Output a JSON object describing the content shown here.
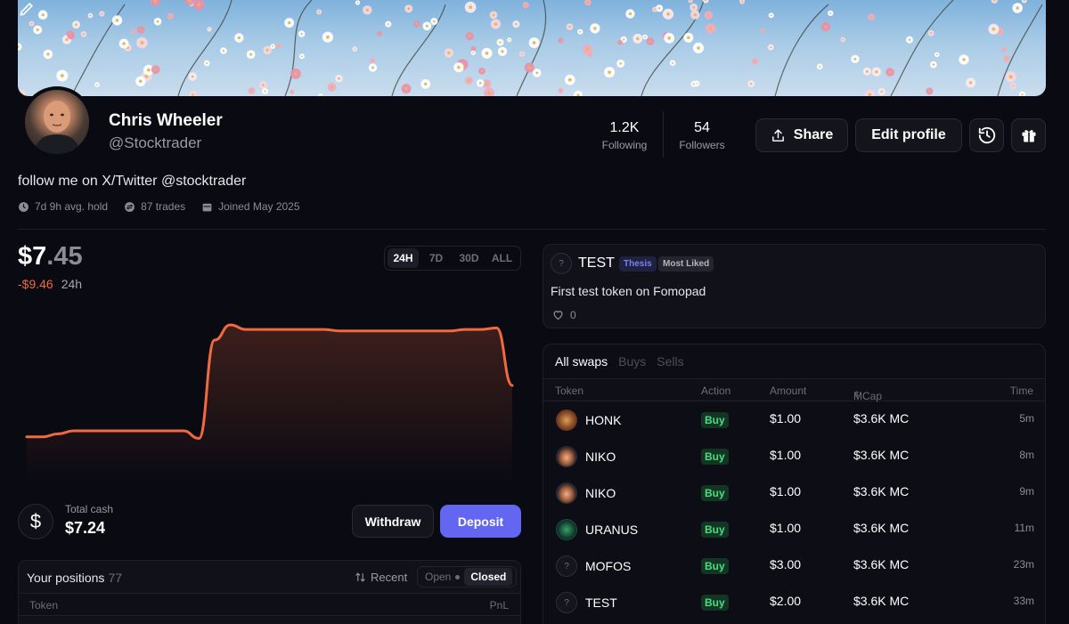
{
  "profile": {
    "display_name": "Chris Wheeler",
    "username": "@Stocktrader",
    "bio": "follow me on X/Twitter @stocktrader",
    "meta": {
      "avg_hold": "7d 9h avg. hold",
      "trades": "87 trades",
      "joined": "Joined May 2025"
    }
  },
  "stats": {
    "following": {
      "value": "1.2K",
      "label": "Following"
    },
    "followers": {
      "value": "54",
      "label": "Followers"
    }
  },
  "actions": {
    "share": "Share",
    "edit_profile": "Edit profile"
  },
  "portfolio": {
    "value_main": "$7",
    "value_frac": ".45",
    "change": "-$9.46",
    "period": "24h",
    "ranges": [
      "24H",
      "7D",
      "30D",
      "ALL"
    ],
    "active_range": "24H",
    "chart_points": [
      0.26,
      0.26,
      0.28,
      0.3,
      0.3,
      0.3,
      0.3,
      0.3,
      0.3,
      0.3,
      0.3,
      0.25,
      0.9,
      1.0,
      0.97,
      0.97,
      0.97,
      0.97,
      0.97,
      0.97,
      0.96,
      0.96,
      0.96,
      0.96,
      0.96,
      0.96,
      0.96,
      0.96,
      0.97,
      0.97,
      0.98,
      0.6
    ],
    "line_color": "#f0693f"
  },
  "cash": {
    "label": "Total cash",
    "value": "$7.24",
    "withdraw": "Withdraw",
    "deposit": "Deposit"
  },
  "positions": {
    "title": "Your positions",
    "count": "77",
    "sort": "Recent",
    "open": "Open",
    "closed": "Closed",
    "col_token": "Token",
    "col_pnl": "PnL"
  },
  "thesis": {
    "token": "TEST",
    "badge_thesis": "Thesis",
    "badge_liked": "Most Liked",
    "description": "First test token on Fomopad",
    "likes": "0"
  },
  "swaps": {
    "tabs": [
      "All swaps",
      "Buys",
      "Sells"
    ],
    "columns": {
      "token": "Token",
      "action": "Action",
      "amount": "Amount",
      "mcap": "MCap",
      "time": "Time"
    },
    "rows": [
      {
        "token": "HONK",
        "icon": "honk",
        "action": "Buy",
        "amount": "$1.00",
        "mcap": "$3.6K MC",
        "time": "5m"
      },
      {
        "token": "NIKO",
        "icon": "niko",
        "action": "Buy",
        "amount": "$1.00",
        "mcap": "$3.6K MC",
        "time": "8m"
      },
      {
        "token": "NIKO",
        "icon": "niko",
        "action": "Buy",
        "amount": "$1.00",
        "mcap": "$3.6K MC",
        "time": "9m"
      },
      {
        "token": "URANUS",
        "icon": "uranus",
        "action": "Buy",
        "amount": "$1.00",
        "mcap": "$3.6K MC",
        "time": "11m"
      },
      {
        "token": "MOFOS",
        "icon": "unk",
        "action": "Buy",
        "amount": "$3.00",
        "mcap": "$3.6K MC",
        "time": "23m"
      },
      {
        "token": "TEST",
        "icon": "unk",
        "action": "Buy",
        "amount": "$2.00",
        "mcap": "$3.6K MC",
        "time": "33m"
      }
    ]
  }
}
